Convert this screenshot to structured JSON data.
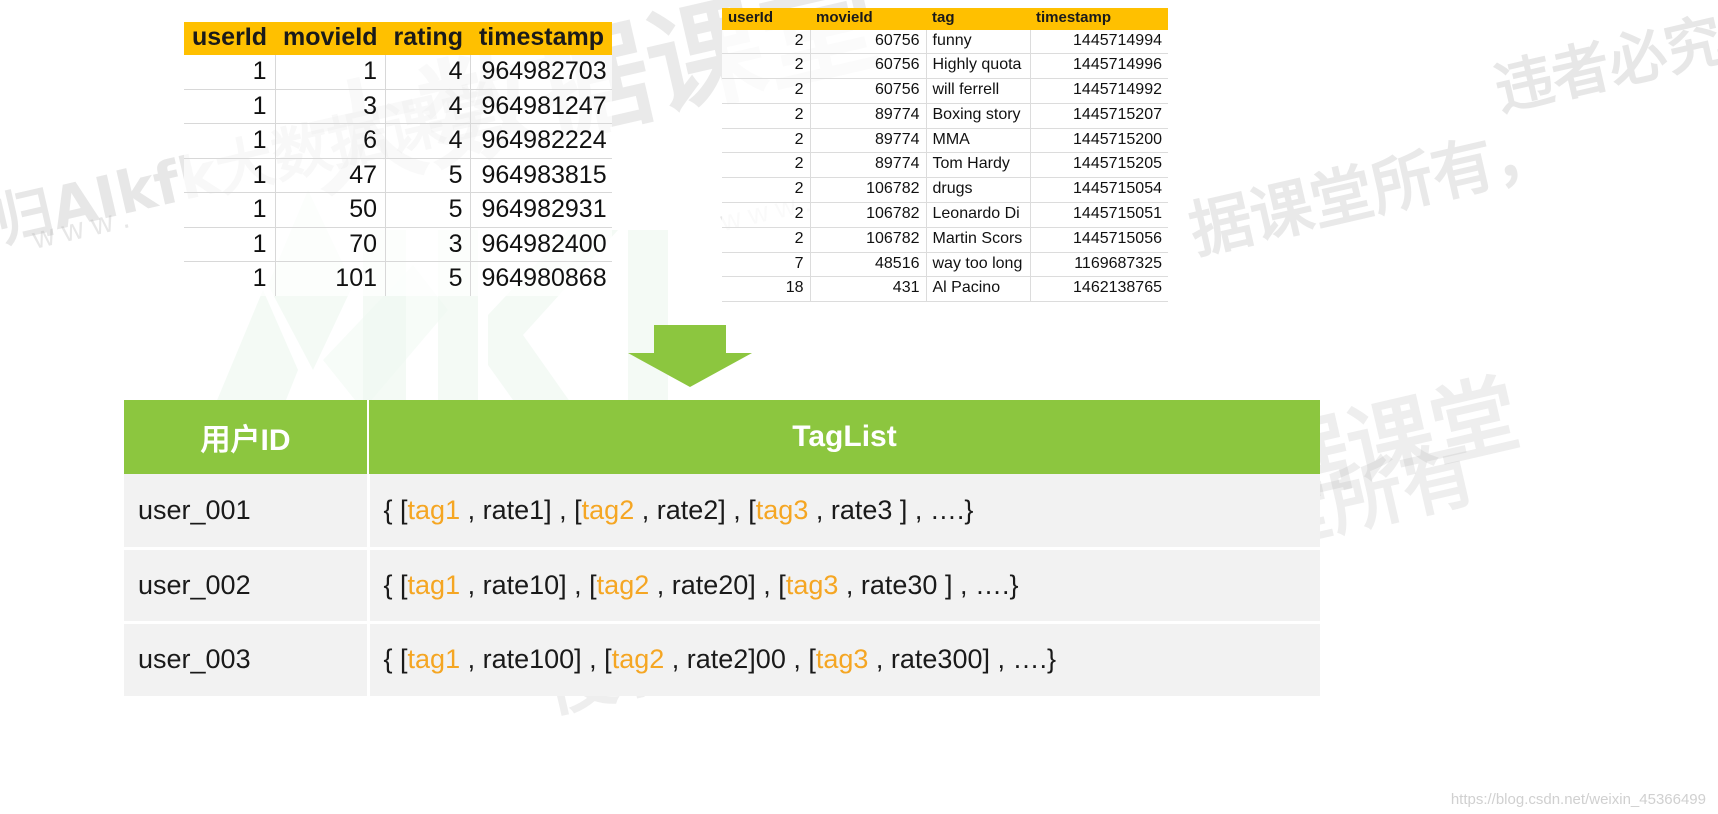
{
  "colors": {
    "header_orange": "#FFC000",
    "header_green": "#8CC63F",
    "row_gray": "#F2F2F2",
    "tag_orange": "#F5A623",
    "arrow_green": "#8CC63F"
  },
  "ratings_table": {
    "name": "ratings",
    "columns": [
      "userId",
      "movieId",
      "rating",
      "timestamp"
    ],
    "rows": [
      [
        "1",
        "1",
        "4",
        "964982703"
      ],
      [
        "1",
        "3",
        "4",
        "964981247"
      ],
      [
        "1",
        "6",
        "4",
        "964982224"
      ],
      [
        "1",
        "47",
        "5",
        "964983815"
      ],
      [
        "1",
        "50",
        "5",
        "964982931"
      ],
      [
        "1",
        "70",
        "3",
        "964982400"
      ],
      [
        "1",
        "101",
        "5",
        "964980868"
      ]
    ]
  },
  "tags_table": {
    "name": "tags",
    "columns": [
      "userId",
      "movieId",
      "tag",
      "timestamp"
    ],
    "rows": [
      [
        "2",
        "60756",
        "funny",
        "1445714994"
      ],
      [
        "2",
        "60756",
        "Highly quota",
        "1445714996"
      ],
      [
        "2",
        "60756",
        "will ferrell",
        "1445714992"
      ],
      [
        "2",
        "89774",
        "Boxing story",
        "1445715207"
      ],
      [
        "2",
        "89774",
        "MMA",
        "1445715200"
      ],
      [
        "2",
        "89774",
        "Tom Hardy",
        "1445715205"
      ],
      [
        "2",
        "106782",
        "drugs",
        "1445715054"
      ],
      [
        "2",
        "106782",
        "Leonardo Di",
        "1445715051"
      ],
      [
        "2",
        "106782",
        "Martin Scors",
        "1445715056"
      ],
      [
        "7",
        "48516",
        "way too long",
        "1169687325"
      ],
      [
        "18",
        "431",
        "Al Pacino",
        "1462138765"
      ]
    ]
  },
  "arrow": {
    "direction": "down",
    "label": "transform-arrow"
  },
  "result_table": {
    "columns": [
      "用户ID",
      "TagList"
    ],
    "rows": [
      {
        "user": "user_001",
        "taglist_parts": [
          {
            "t": "{ [",
            "tag": false
          },
          {
            "t": "tag1",
            "tag": true
          },
          {
            "t": " , rate1] , [",
            "tag": false
          },
          {
            "t": "tag2",
            "tag": true
          },
          {
            "t": " , rate2] , [",
            "tag": false
          },
          {
            "t": "tag3",
            "tag": true
          },
          {
            "t": " , rate3 ] , ….}",
            "tag": false
          }
        ]
      },
      {
        "user": "user_002",
        "taglist_parts": [
          {
            "t": "{ [",
            "tag": false
          },
          {
            "t": "tag1",
            "tag": true
          },
          {
            "t": " , rate10] , [",
            "tag": false
          },
          {
            "t": "tag2",
            "tag": true
          },
          {
            "t": " , rate20] , [",
            "tag": false
          },
          {
            "t": "tag3",
            "tag": true
          },
          {
            "t": " , rate30 ] , ….}",
            "tag": false
          }
        ]
      },
      {
        "user": "user_003",
        "taglist_parts": [
          {
            "t": "{ [",
            "tag": false
          },
          {
            "t": "tag1",
            "tag": true
          },
          {
            "t": " , rate100] , [",
            "tag": false
          },
          {
            "t": "tag2",
            "tag": true
          },
          {
            "t": " , rate2]00 , [",
            "tag": false
          },
          {
            "t": "tag3",
            "tag": true
          },
          {
            "t": " , rate300] , ….}",
            "tag": false
          }
        ]
      }
    ]
  },
  "watermarks": {
    "csdn_url": "https://blog.csdn.net/weixin_45366499",
    "logo_text": "AIKFK",
    "cn_left": "归AIkfk大数据课堂",
    "cn_center_top": "大数据课堂",
    "cn_right_top": "违者必究",
    "cn_right_mid": "据课堂所有，",
    "cn_bottom": "侵权归AIkfk大数据课堂所有",
    "www_left": "w w w .",
    "www_mid": "w w w ."
  }
}
